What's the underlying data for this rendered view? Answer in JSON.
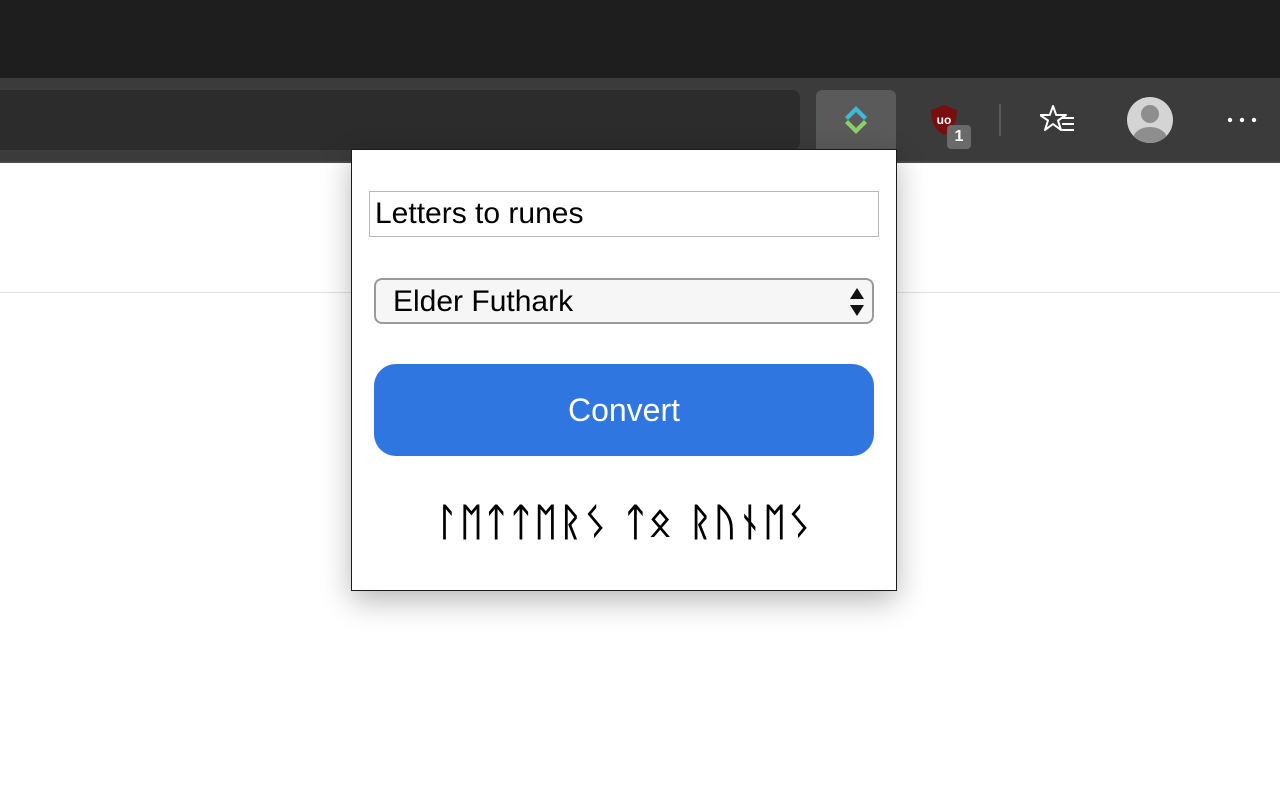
{
  "browser": {
    "extensions": [
      {
        "name": "rune-converter-icon",
        "active": true
      },
      {
        "name": "ublock-origin-icon",
        "badge": "1"
      }
    ],
    "favorites_icon": "star-with-lines-icon",
    "profile_icon": "avatar-icon",
    "menu_icon": "ellipsis-icon"
  },
  "popup": {
    "input": {
      "value": "Letters to runes"
    },
    "select": {
      "value": "Elder Futhark"
    },
    "convert_label": "Convert",
    "output": "ᛚᛖᛏᛏᛖᚱᛊ ᛏᛟ ᚱᚢᚾᛖᛊ"
  },
  "colors": {
    "accent": "#3076e0",
    "toolbar": "#3b3b3b",
    "titlebar": "#1e1e1e"
  }
}
